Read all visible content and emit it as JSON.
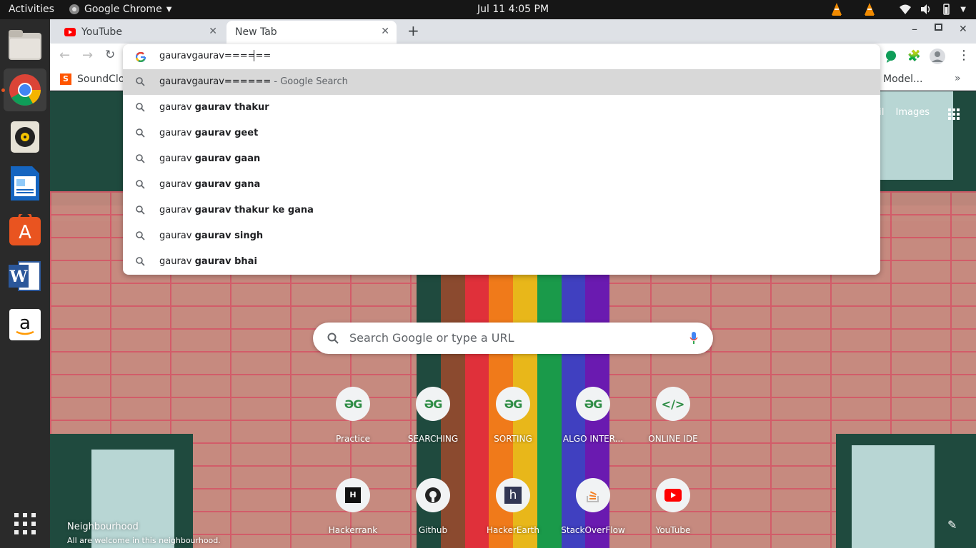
{
  "topbar": {
    "activities": "Activities",
    "app_name": "Google Chrome",
    "clock": "Jul 11  4:05 PM"
  },
  "tabs": [
    {
      "title": "YouTube",
      "active": false
    },
    {
      "title": "New Tab",
      "active": true
    }
  ],
  "bookmarks": {
    "first": "SoundClo",
    "last": "o Model..."
  },
  "omnibox": {
    "input_value": "gauravgaurav======",
    "suggestions": [
      {
        "query": "gauravgaurav======",
        "suffix": " - Google Search"
      },
      {
        "prefix": "gaurav ",
        "rest": "gaurav thakur"
      },
      {
        "prefix": "gaurav ",
        "rest": "gaurav geet"
      },
      {
        "prefix": "gaurav ",
        "rest": "gaurav gaan"
      },
      {
        "prefix": "gaurav ",
        "rest": "gaurav gana"
      },
      {
        "prefix": "gaurav ",
        "rest": "gaurav thakur ke gana"
      },
      {
        "prefix": "gaurav ",
        "rest": "gaurav singh"
      },
      {
        "prefix": "gaurav ",
        "rest": "gaurav bhai"
      }
    ]
  },
  "ntp": {
    "top_links": [
      "ail",
      "Images"
    ],
    "search_placeholder": "Search Google or type a URL",
    "shortcuts": [
      {
        "label": "Practice"
      },
      {
        "label": "SEARCHING"
      },
      {
        "label": "SORTING"
      },
      {
        "label": "ALGO INTER..."
      },
      {
        "label": "ONLINE IDE"
      },
      {
        "label": "Hackerrank"
      },
      {
        "label": "Github"
      },
      {
        "label": "HackerEarth"
      },
      {
        "label": "StackOverFlow"
      },
      {
        "label": "YouTube"
      }
    ],
    "attribution_title": "Neighbourhood",
    "attribution_sub": "All are welcome in this neighbourhood."
  },
  "colors": {
    "accent_ubuntu": "#e95420",
    "gfg_green": "#2f8d46",
    "youtube_red": "#ff0000"
  }
}
